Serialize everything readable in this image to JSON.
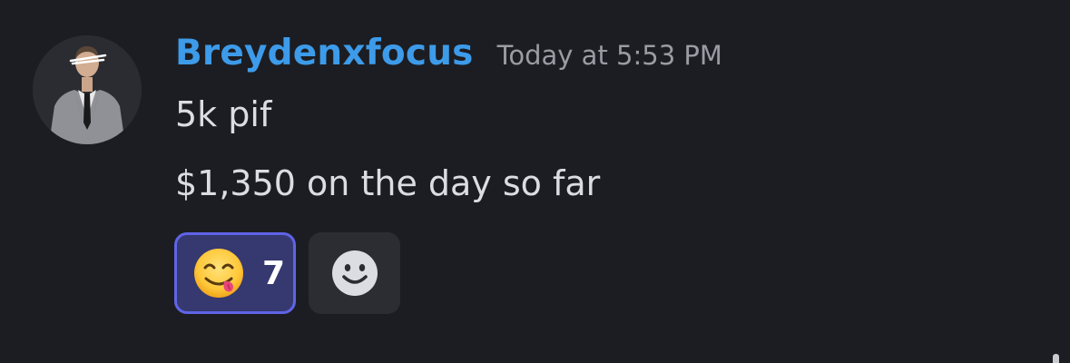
{
  "message": {
    "author": "Breydenxfocus",
    "timestamp": "Today at 5:53 PM",
    "lines": [
      "5k pif",
      "$1,350 on the day so far"
    ],
    "avatar_icon": "user-avatar-man-in-suit",
    "reactions": [
      {
        "emoji_icon": "face-savoring-food-emoji",
        "count": "7",
        "selected": true
      }
    ],
    "add_reaction_icon": "smiley-add-reaction-icon"
  },
  "colors": {
    "background": "#1c1d22",
    "username": "#3d9be9",
    "timestamp": "#9a9ba3",
    "text": "#dcdde2",
    "reaction_bg": "#363870",
    "reaction_border": "#5f64e6",
    "add_reaction_bg": "#2c2d33"
  }
}
